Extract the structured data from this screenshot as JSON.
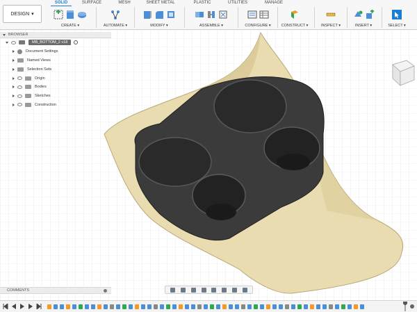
{
  "workspace": {
    "label": "DESIGN",
    "caret": "▾"
  },
  "tabs": [
    "SOLID",
    "SURFACE",
    "MESH",
    "SHEET METAL",
    "PLASTIC",
    "UTILITIES",
    "MANAGE"
  ],
  "active_tab": "SOLID",
  "groups": [
    "CREATE ▾",
    "AUTOMATE ▾",
    "MODIFY ▾",
    "ASSEMBLE ▾",
    "CONFIGURE ▾",
    "CONSTRUCT ▾",
    "INSPECT ▾",
    "INSERT ▾",
    "SELECT ▾"
  ],
  "browser": {
    "title": "BROWSER",
    "root": "MB_BOTTOM_2 v18",
    "items": [
      "Document Settings",
      "Named Views",
      "Selection Sets",
      "Origin",
      "Bodies",
      "Sketches",
      "Construction"
    ]
  },
  "comments": {
    "title": "COMMENTS"
  },
  "colors": {
    "accent": "#1a7fd4",
    "part_fill": "#e8dcb0",
    "insert_fill": "#3b3b3b"
  },
  "icons": [
    "new-component-icon",
    "extrude-icon",
    "revolve-icon",
    "automate-icon",
    "press-pull-icon",
    "fillet-icon",
    "shell-icon",
    "combine-icon",
    "joint-icon",
    "rigid-group-icon",
    "parameters-icon",
    "table-icon",
    "plane-icon",
    "measure-icon",
    "insert-mesh-icon",
    "insert-derive-icon",
    "select-icon",
    "viewcube-icon",
    "orbit-icon",
    "pan-icon",
    "zoom-icon",
    "fit-icon",
    "display-icon",
    "grid-icon",
    "play-icon",
    "gear-icon"
  ]
}
